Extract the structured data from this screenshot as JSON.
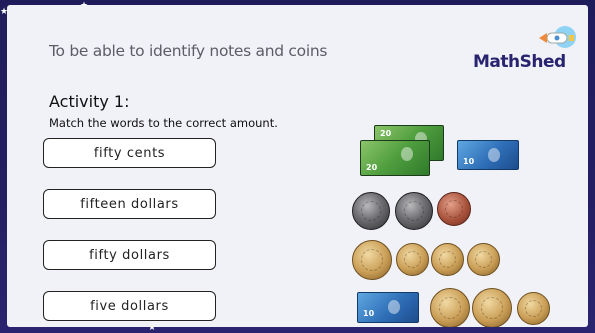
{
  "lesson": {
    "objective": "To be able to identify notes and coins",
    "brand": "MathShed"
  },
  "activity": {
    "title": "Activity 1:",
    "instruction": "Match the words to the correct amount."
  },
  "options": [
    {
      "label": "fifty cents"
    },
    {
      "label": "fifteen dollars"
    },
    {
      "label": "fifty dollars"
    },
    {
      "label": "five dollars"
    }
  ],
  "notes": {
    "twenty_label": "20",
    "ten_label": "10"
  },
  "colors": {
    "background": "#221e60",
    "slide": "#f1f1f8",
    "brand": "#29246f"
  }
}
